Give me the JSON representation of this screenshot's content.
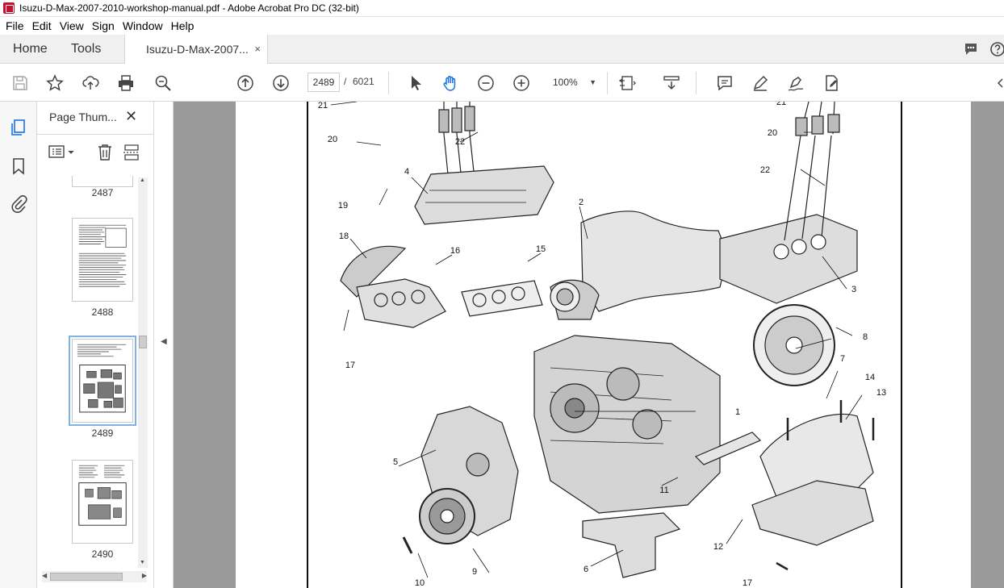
{
  "window": {
    "title": "Isuzu-D-Max-2007-2010-workshop-manual.pdf - Adobe Acrobat Pro DC (32-bit)"
  },
  "menu": [
    "File",
    "Edit",
    "View",
    "Sign",
    "Window",
    "Help"
  ],
  "tabs": {
    "home": "Home",
    "tools": "Tools",
    "document": "Isuzu-D-Max-2007...",
    "close": "×"
  },
  "toolbar": {
    "current_page": "2489",
    "page_separator": "/",
    "total_pages": "6021",
    "zoom": "100%"
  },
  "sidebar": {
    "panel_title": "Page Thum...",
    "close": "✕"
  },
  "thumbnails": [
    {
      "label": "2487"
    },
    {
      "label": "2488"
    },
    {
      "label": "2489"
    },
    {
      "label": "2490"
    }
  ],
  "diagram": {
    "callouts": [
      "21",
      "20",
      "22",
      "4",
      "19",
      "18",
      "16",
      "15",
      "2",
      "17",
      "5",
      "1",
      "9",
      "10",
      "6",
      "11",
      "12",
      "13",
      "14",
      "7",
      "8",
      "3",
      "22",
      "20",
      "21",
      "17"
    ]
  }
}
